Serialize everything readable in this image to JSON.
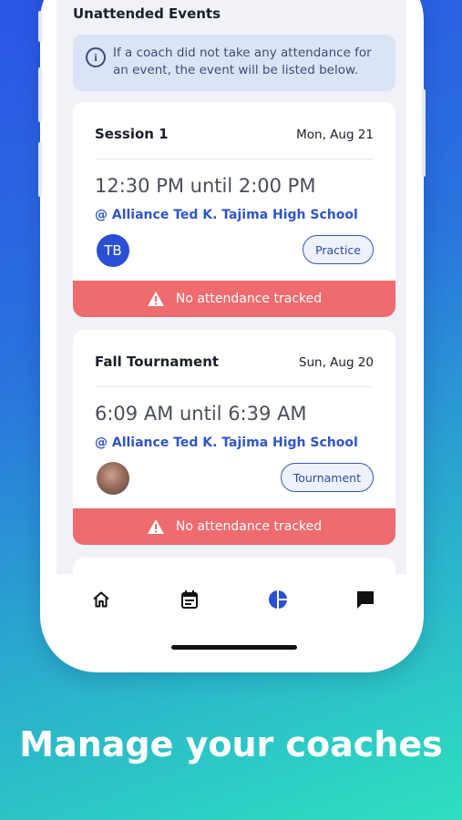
{
  "section": {
    "title": "Unattended Events",
    "info": "If a coach did not take any attendance for an event, the event will be listed below."
  },
  "events": [
    {
      "title": "Session 1",
      "date": "Mon, Aug 21",
      "time": "12:30 PM until 2:00 PM",
      "location": "@ Alliance Ted K. Tajima High School",
      "avatar_initials": "TB",
      "tag": "Practice",
      "alert": "No attendance tracked"
    },
    {
      "title": "Fall Tournament",
      "date": "Sun, Aug 20",
      "time": "6:09 AM until 6:39 AM",
      "location": "@ Alliance Ted K. Tajima High School",
      "tag": "Tournament",
      "alert": "No attendance tracked"
    }
  ],
  "nav": [
    {
      "icon": "home-icon",
      "active": false
    },
    {
      "icon": "calendar-icon",
      "active": false
    },
    {
      "icon": "pie-chart-icon",
      "active": true
    },
    {
      "icon": "chat-icon",
      "active": false
    }
  ],
  "colors": {
    "accent": "#2a4fd4",
    "alert": "#ef6b6e",
    "link": "#3055c8"
  },
  "headline": "Manage your coaches"
}
